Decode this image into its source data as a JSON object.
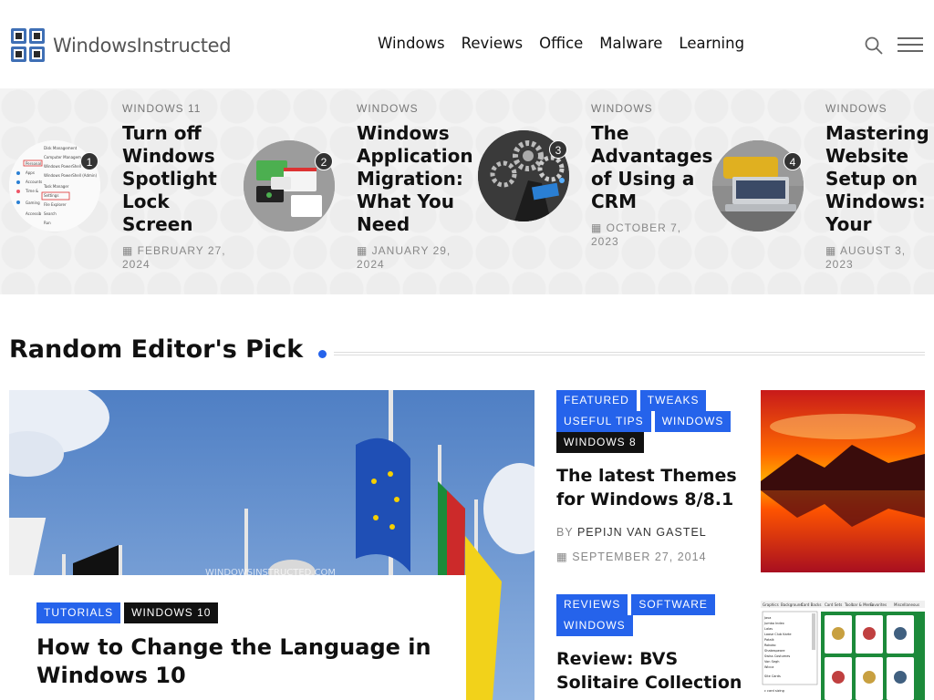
{
  "header": {
    "logo_text": "WindowsInstructed",
    "nav": [
      "Windows",
      "Reviews",
      "Office",
      "Malware",
      "Learning"
    ]
  },
  "featured": [
    {
      "num": "1",
      "category": "WINDOWS 11",
      "title": "Turn off Windows Spotlight Lock Screen",
      "date": "FEBRUARY 27, 2024"
    },
    {
      "num": "2",
      "category": "WINDOWS",
      "title": "Windows Application Migration: What You Need",
      "date": "JANUARY 29, 2024"
    },
    {
      "num": "3",
      "category": "WINDOWS",
      "title": "The Advantages of Using a CRM",
      "date": "OCTOBER 7, 2023"
    },
    {
      "num": "4",
      "category": "WINDOWS",
      "title": "Mastering Website Setup on Windows: Your",
      "date": "AUGUST 3, 2023"
    }
  ],
  "section": {
    "title": "Random Editor's Pick"
  },
  "main_pick": {
    "tags": [
      "TUTORIALS",
      "WINDOWS 10"
    ],
    "title": "How to Change the Language in Windows 10",
    "watermark": "WINDOWSINSTRUCTED.COM"
  },
  "side_picks": [
    {
      "tags": [
        "FEATURED",
        "TWEAKS",
        "USEFUL TIPS",
        "WINDOWS",
        "WINDOWS 8"
      ],
      "title": "The latest Themes for Windows 8/8.1",
      "by_label": "BY",
      "author": "PEPIJN VAN GASTEL",
      "date": "SEPTEMBER 27, 2014"
    },
    {
      "tags": [
        "REVIEWS",
        "SOFTWARE",
        "WINDOWS"
      ],
      "title": "Review: BVS Solitaire Collection"
    }
  ],
  "colors": {
    "accent": "#2563eb",
    "dark_tag": "#111111"
  }
}
